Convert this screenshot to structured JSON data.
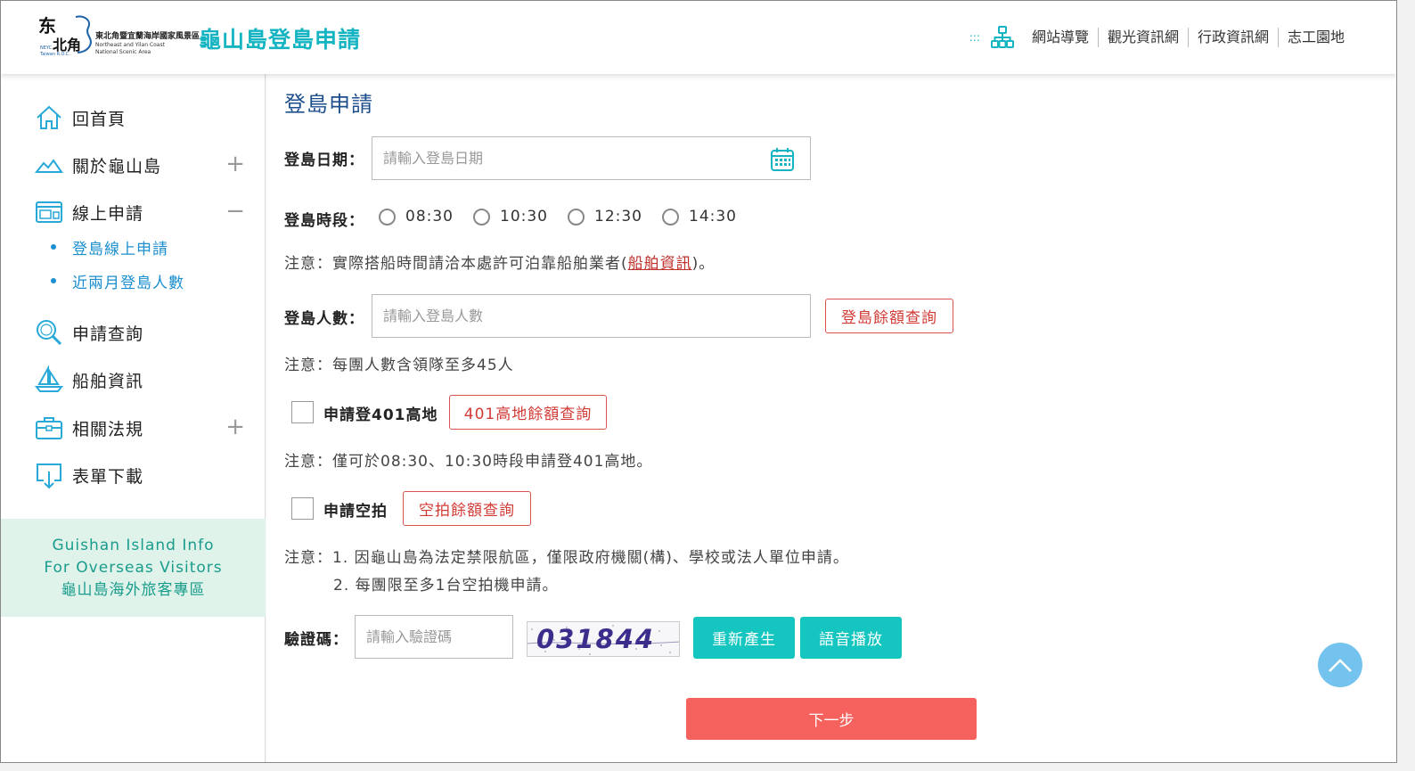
{
  "header": {
    "logo": {
      "calligraphy_top": "东",
      "calligraphy_bottom": "北角",
      "small_line1": "NEYC",
      "small_line2": "Taiwan R.O.C.",
      "cn_name": "東北角暨宜蘭海岸國家風景區",
      "en_line1": "Northeast and Yilan Coast",
      "en_line2": "National Scenic Area"
    },
    "site_title": "龜山島登島申請",
    "dots": ":::",
    "nav": [
      {
        "label": "網站導覽",
        "icon": "sitemap-icon"
      },
      {
        "label": "觀光資訊網"
      },
      {
        "label": "行政資訊網"
      },
      {
        "label": "志工園地"
      }
    ]
  },
  "sidebar": {
    "items": [
      {
        "label": "回首頁",
        "icon": "home-icon"
      },
      {
        "label": "關於龜山島",
        "icon": "mountain-icon",
        "toggle": "+"
      },
      {
        "label": "線上申請",
        "icon": "browser-form-icon",
        "toggle": "−"
      },
      {
        "label": "申請查詢",
        "icon": "search-icon"
      },
      {
        "label": "船舶資訊",
        "icon": "boat-icon"
      },
      {
        "label": "相關法規",
        "icon": "briefcase-icon",
        "toggle": "+"
      },
      {
        "label": "表單下載",
        "icon": "download-icon"
      }
    ],
    "sub_items": [
      {
        "label": "登島線上申請"
      },
      {
        "label": "近兩月登島人數"
      }
    ],
    "overseas": {
      "line1": "Guishan Island Info",
      "line2": "For Overseas Visitors",
      "line3": "龜山島海外旅客專區"
    }
  },
  "main": {
    "title": "登島申請",
    "date": {
      "label": "登島日期：",
      "placeholder": "請輸入登島日期",
      "value": ""
    },
    "time_slot": {
      "label": "登島時段：",
      "options": [
        "08:30",
        "10:30",
        "12:30",
        "14:30"
      ],
      "selected": ""
    },
    "note1": {
      "prefix": "注意：實際搭船時間請洽本處許可泊靠船舶業者(",
      "link": "船舶資訊",
      "suffix": ")。"
    },
    "people": {
      "label": "登島人數：",
      "placeholder": "請輸入登島人數",
      "value": "",
      "quota_button": "登島餘額查詢"
    },
    "note2": "注意：每團人數含領隊至多45人",
    "highland": {
      "label": "申請登401高地",
      "checked": false,
      "quota_button": "401高地餘額查詢"
    },
    "note3": "注意：僅可於08:30、10:30時段申請登401高地。",
    "aerial": {
      "label": "申請空拍",
      "checked": false,
      "quota_button": "空拍餘額查詢"
    },
    "note4_line1": "注意：1. 因龜山島為法定禁限航區，僅限政府機關(構)、學校或法人單位申請。",
    "note4_line2": "2. 每團限至多1台空拍機申請。",
    "captcha": {
      "label": "驗證碼：",
      "placeholder": "請輸入驗證碼",
      "value": "",
      "image_text": "031844",
      "regenerate_button": "重新產生",
      "audio_button": "語音播放"
    },
    "next_button": "下一步"
  },
  "colors": {
    "brand_teal": "#15b4c2",
    "title_blue": "#1e4f8d",
    "link_blue": "#1b8fcf",
    "danger_red": "#d23b35",
    "next_button": "#f5615c",
    "teal_button": "#15c6c0",
    "overseas_bg": "#dff3ea",
    "back_to_top": "#74c3ef"
  }
}
